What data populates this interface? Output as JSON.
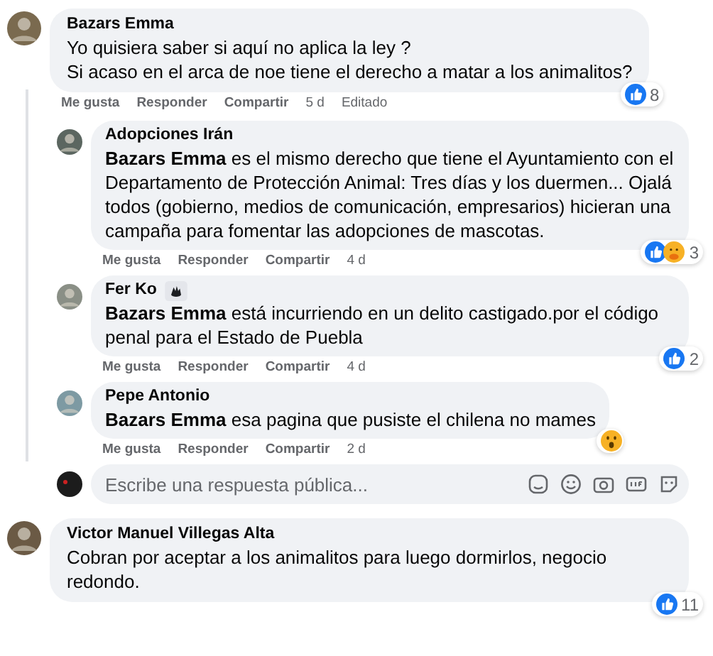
{
  "comments": [
    {
      "author": "Bazars Emma",
      "badge": false,
      "lines": [
        "Yo quisiera saber si aquí no aplica la ley ?",
        "Si acaso en el arca de noe tiene el derecho a matar a los animalitos?"
      ],
      "actions": [
        "Me gusta",
        "Responder",
        "Compartir"
      ],
      "time": "5 d",
      "edited": "Editado",
      "reaction": {
        "kind": "like",
        "count": "8"
      },
      "replies": [
        {
          "author": "Adopciones Irán",
          "badge": false,
          "lines": [
            "**Bazars Emma** es el mismo derecho que tiene el Ayuntamiento con el Departamento de Protección Animal: Tres días y los duermen... Ojalá todos (gobierno, medios de comunicación, empresarios) hicieran una campaña para fomentar las adopciones de mascotas."
          ],
          "actions": [
            "Me gusta",
            "Responder",
            "Compartir"
          ],
          "time": "4 d",
          "reaction": {
            "kind": "like-care",
            "count": "3"
          }
        },
        {
          "author": "Fer Ko",
          "badge": true,
          "lines": [
            "**Bazars Emma** está incurriendo en un delito castigado.por el código penal para el Estado de Puebla"
          ],
          "actions": [
            "Me gusta",
            "Responder",
            "Compartir"
          ],
          "time": "4 d",
          "reaction": {
            "kind": "like",
            "count": "2"
          }
        },
        {
          "author": "Pepe Antonio",
          "badge": false,
          "lines": [
            "**Bazars Emma** esa pagina que pusiste el chilena no mames"
          ],
          "actions": [
            "Me gusta",
            "Responder",
            "Compartir"
          ],
          "time": "2 d",
          "reaction": {
            "kind": "wow"
          }
        }
      ],
      "reply_box": {
        "placeholder": "Escribe una respuesta pública..."
      }
    },
    {
      "author": "Victor Manuel Villegas Alta",
      "badge": false,
      "lines": [
        "Cobran por aceptar a los animalitos para luego dormirlos, negocio redondo."
      ],
      "reaction": {
        "kind": "like",
        "count": "11"
      }
    }
  ]
}
